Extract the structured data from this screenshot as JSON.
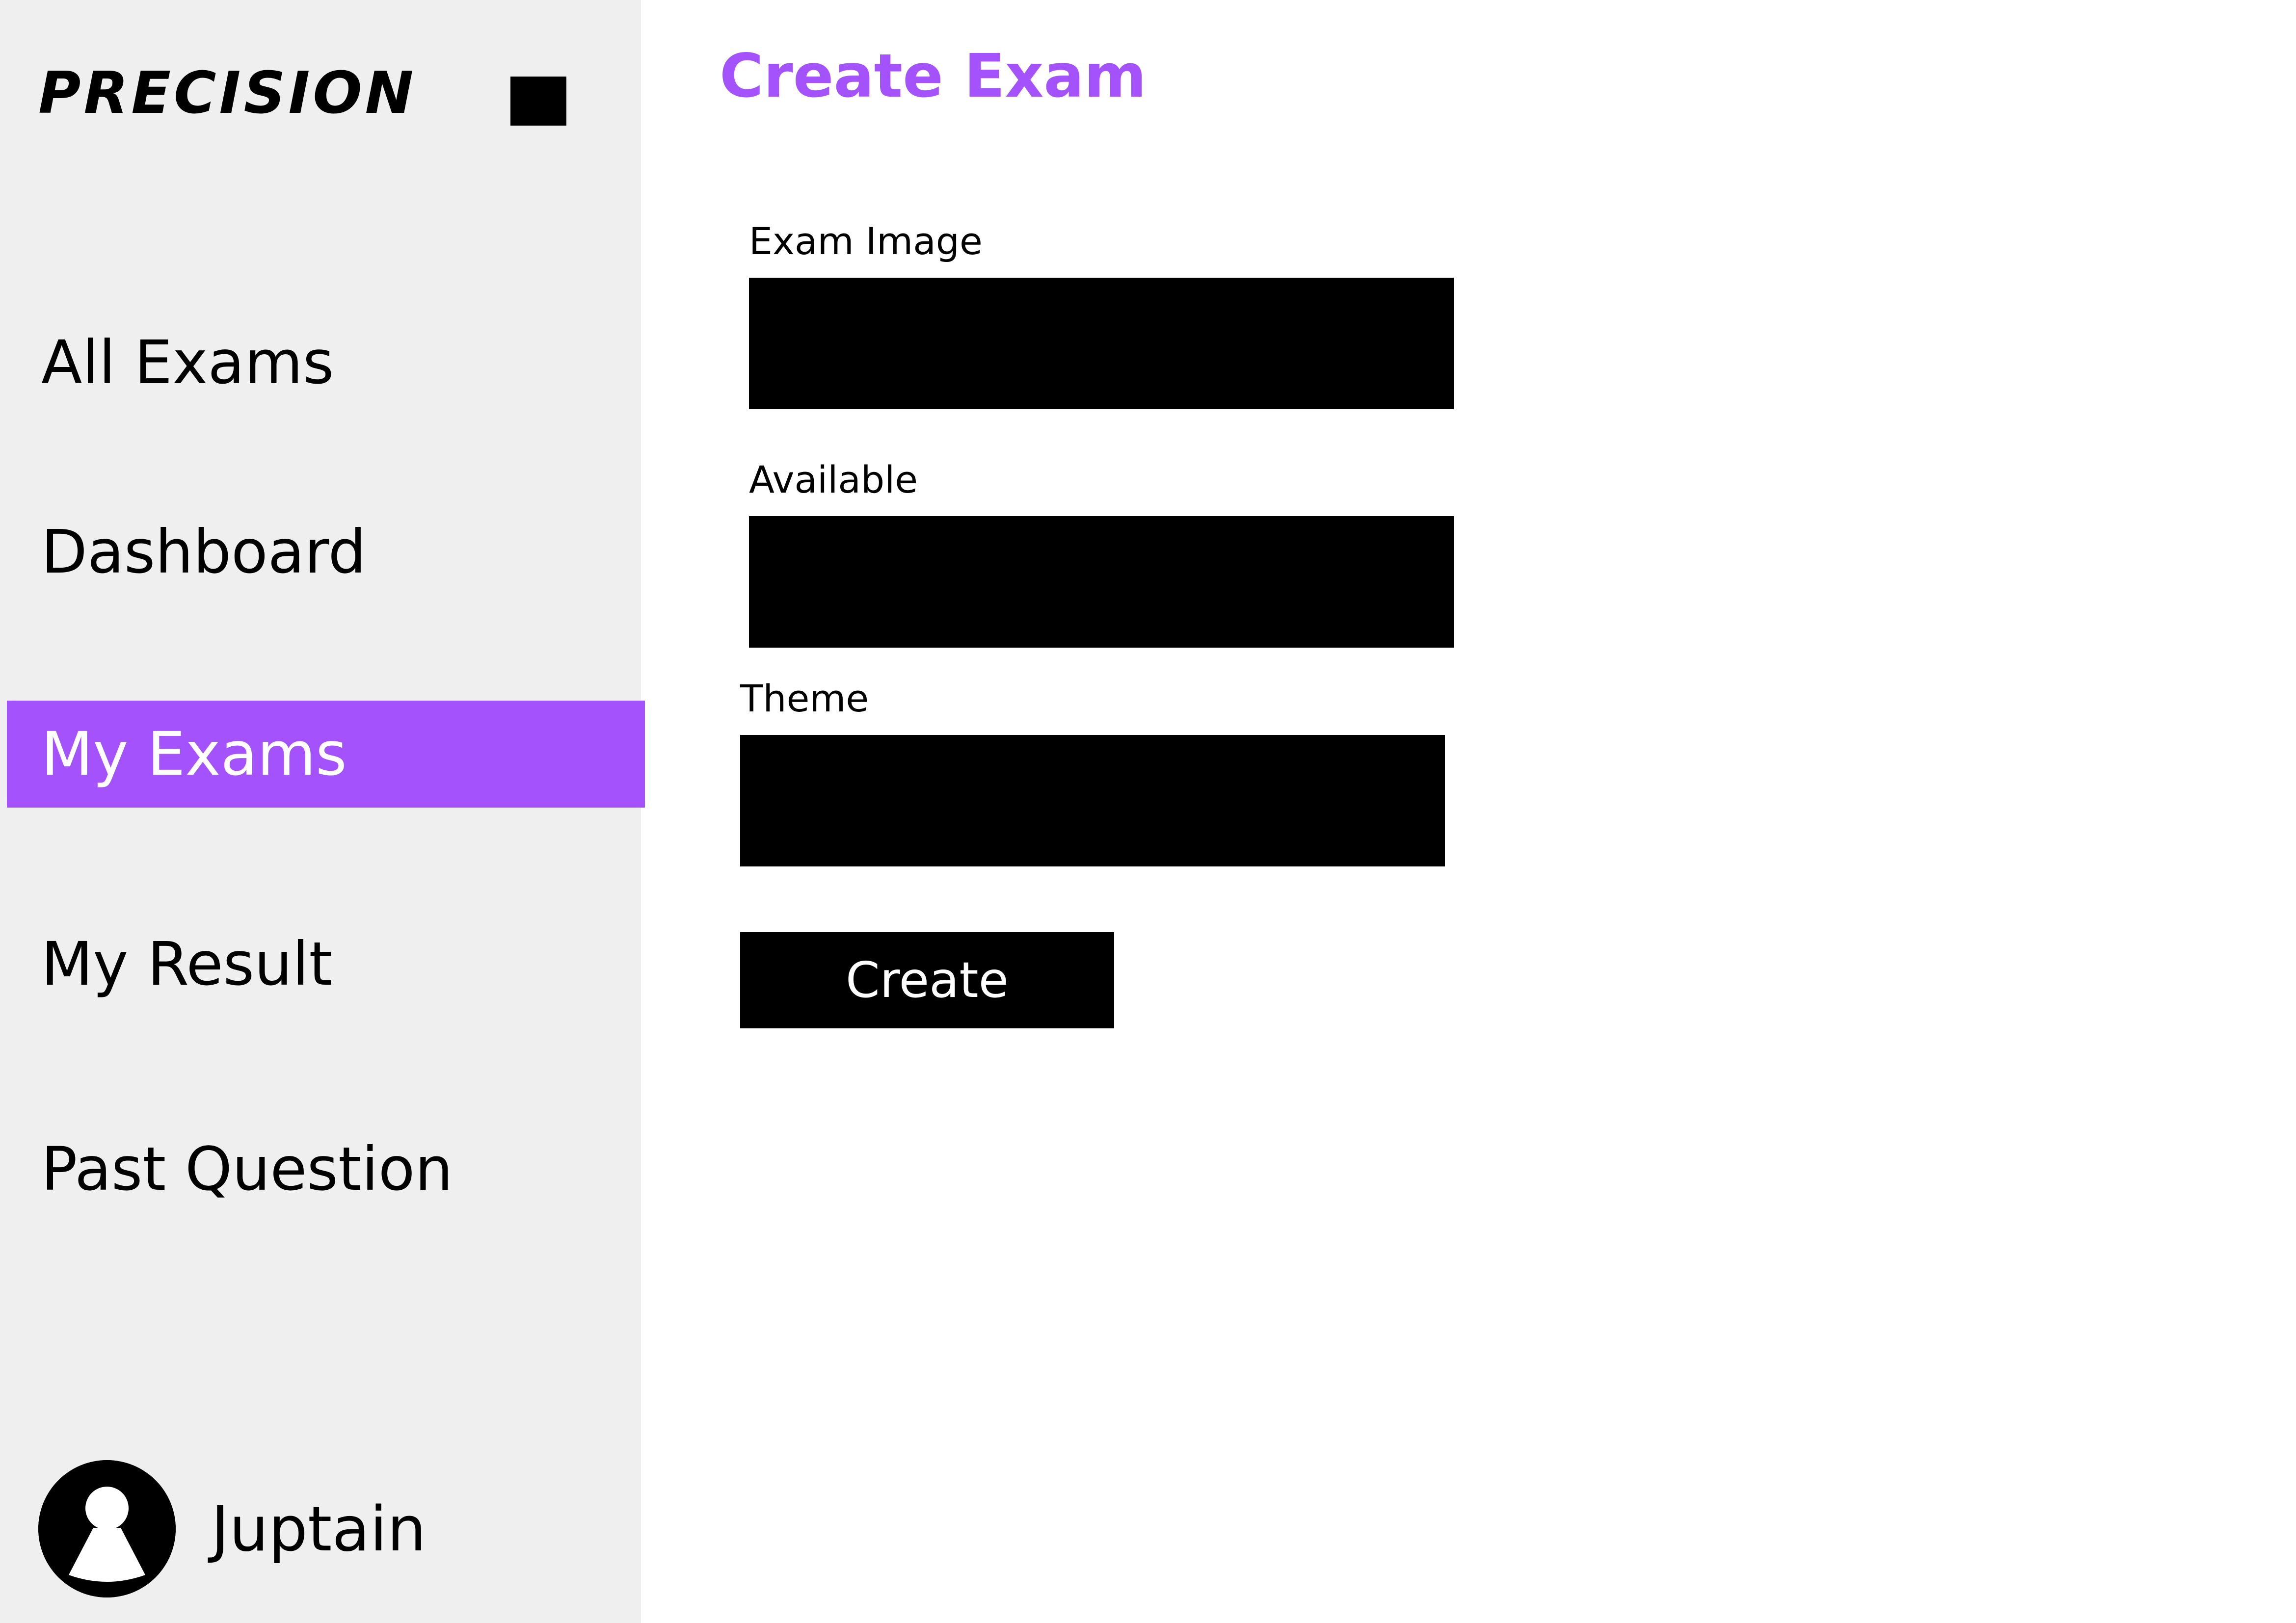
{
  "brand": {
    "logo_text": "PRECISION"
  },
  "sidebar": {
    "toggle_icon": "menu-toggle-icon",
    "items": [
      {
        "label": "All Exams",
        "active": false
      },
      {
        "label": "Dashboard",
        "active": false
      },
      {
        "label": "My Exams",
        "active": true
      },
      {
        "label": "My Result",
        "active": false
      },
      {
        "label": "Past Question",
        "active": false
      }
    ]
  },
  "user": {
    "name": "Juptain",
    "avatar_icon": "user-avatar-icon"
  },
  "main": {
    "title": "Create Exam",
    "fields": [
      {
        "label": "Exam Image",
        "value": ""
      },
      {
        "label": "Available",
        "value": ""
      },
      {
        "label": "Theme",
        "value": ""
      }
    ],
    "create_label": "Create"
  },
  "colors": {
    "accent": "#a352fc",
    "sidebar_bg": "#efefef",
    "field_bg": "#000000",
    "text": "#000000"
  }
}
